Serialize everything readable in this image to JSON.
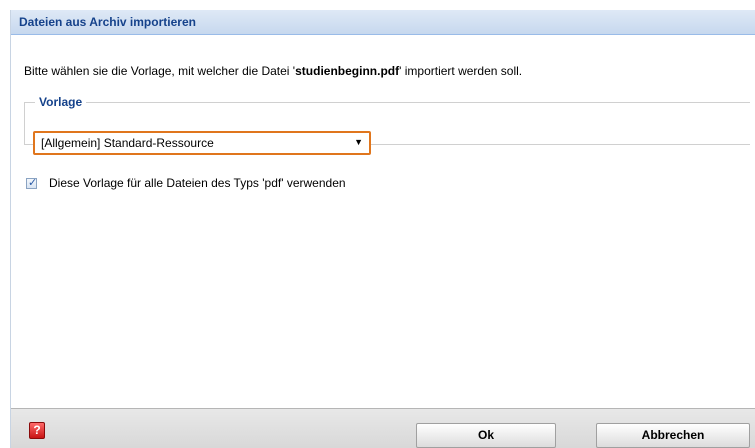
{
  "dialog": {
    "title": "Dateien aus Archiv importieren"
  },
  "prompt": {
    "prefix": "Bitte wählen sie die Vorlage, mit welcher die Datei '",
    "filename": "studienbeginn.pdf",
    "suffix": "' importiert werden soll."
  },
  "vorlage": {
    "legend": "Vorlage",
    "selected": "[Allgemein] Standard-Ressource",
    "arrow_icon": "triangle-down-icon"
  },
  "checkbox": {
    "checked": true,
    "label": "Diese Vorlage für alle Dateien des Typs 'pdf' verwenden"
  },
  "footer": {
    "help_icon": "help-question-icon",
    "help_glyph": "?",
    "ok_label": "Ok",
    "cancel_label": "Abbrechen"
  },
  "colors": {
    "title_text": "#15428b",
    "combo_highlight": "#e0761d"
  }
}
